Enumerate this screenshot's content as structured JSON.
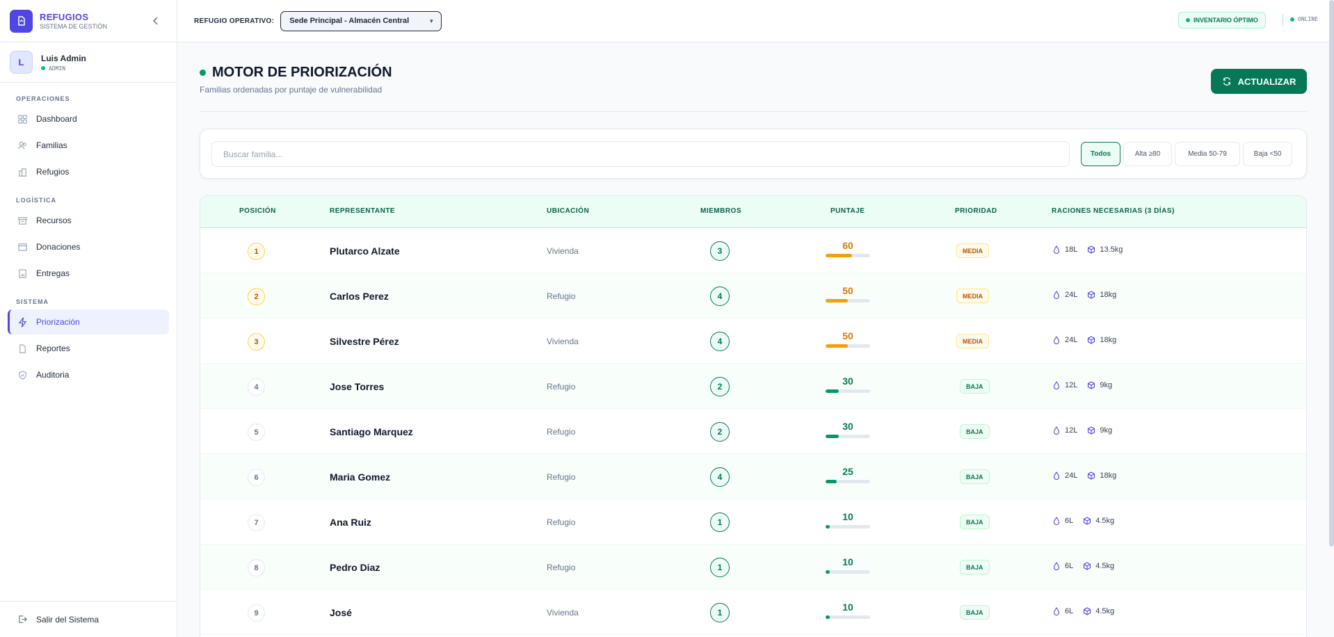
{
  "brand": {
    "title": "REFUGIOS",
    "subtitle": "SISTEMA DE GESTIÓN"
  },
  "user": {
    "initial": "L",
    "name": "Luis Admin",
    "role": "ADMIN"
  },
  "nav": {
    "operaciones": {
      "title": "OPERACIONES",
      "items": [
        "Dashboard",
        "Familias",
        "Refugios"
      ]
    },
    "logistica": {
      "title": "LOGÍSTICA",
      "items": [
        "Recursos",
        "Donaciones",
        "Entregas"
      ]
    },
    "sistema": {
      "title": "SISTEMA",
      "items": [
        "Priorización",
        "Reportes",
        "Auditoria"
      ]
    },
    "logout": "Salir del Sistema"
  },
  "topbar": {
    "refugio_label": "REFUGIO OPERATIVO:",
    "refugio_value": "Sede Principal - Almacén Central",
    "inventory_badge": "INVENTARIO ÓPTIMO",
    "status": "ONLINE"
  },
  "page": {
    "title": "MOTOR DE PRIORIZACIÓN",
    "subtitle": "Familias ordenadas por puntaje de vulnerabilidad",
    "refresh_label": "ACTUALIZAR"
  },
  "filters": {
    "search_placeholder": "Buscar familia...",
    "chips": [
      "Todos",
      "Alta ≥80",
      "Media 50-79",
      "Baja <50"
    ]
  },
  "table": {
    "headers": [
      "POSICIÓN",
      "REPRESENTANTE",
      "UBICACIÓN",
      "MIEMBROS",
      "PUNTAJE",
      "PRIORIDAD",
      "RACIONES NECESARIAS (3 DÍAS)"
    ],
    "rows": [
      {
        "pos": "1",
        "name": "Plutarco Alzate",
        "loc": "Vivienda",
        "members": "3",
        "score": "60",
        "prio": "MEDIA",
        "water": "18L",
        "food": "13.5kg"
      },
      {
        "pos": "2",
        "name": "Carlos Perez",
        "loc": "Refugio",
        "members": "4",
        "score": "50",
        "prio": "MEDIA",
        "water": "24L",
        "food": "18kg"
      },
      {
        "pos": "3",
        "name": "Silvestre Pérez",
        "loc": "Vivienda",
        "members": "4",
        "score": "50",
        "prio": "MEDIA",
        "water": "24L",
        "food": "18kg"
      },
      {
        "pos": "4",
        "name": "Jose Torres",
        "loc": "Refugio",
        "members": "2",
        "score": "30",
        "prio": "BAJA",
        "water": "12L",
        "food": "9kg"
      },
      {
        "pos": "5",
        "name": "Santiago Marquez",
        "loc": "Refugio",
        "members": "2",
        "score": "30",
        "prio": "BAJA",
        "water": "12L",
        "food": "9kg"
      },
      {
        "pos": "6",
        "name": "Maria Gomez",
        "loc": "Refugio",
        "members": "4",
        "score": "25",
        "prio": "BAJA",
        "water": "24L",
        "food": "18kg"
      },
      {
        "pos": "7",
        "name": "Ana Ruiz",
        "loc": "Refugio",
        "members": "1",
        "score": "10",
        "prio": "BAJA",
        "water": "6L",
        "food": "4.5kg"
      },
      {
        "pos": "8",
        "name": "Pedro Diaz",
        "loc": "Refugio",
        "members": "1",
        "score": "10",
        "prio": "BAJA",
        "water": "6L",
        "food": "4.5kg"
      },
      {
        "pos": "9",
        "name": "José",
        "loc": "Vivienda",
        "members": "1",
        "score": "10",
        "prio": "BAJA",
        "water": "6L",
        "food": "4.5kg"
      }
    ]
  },
  "colors": {
    "accent": "#4f46e5",
    "green": "#047857",
    "amber": "#d97706",
    "amber_bar": "#f59e0b",
    "green_bar": "#059669"
  }
}
